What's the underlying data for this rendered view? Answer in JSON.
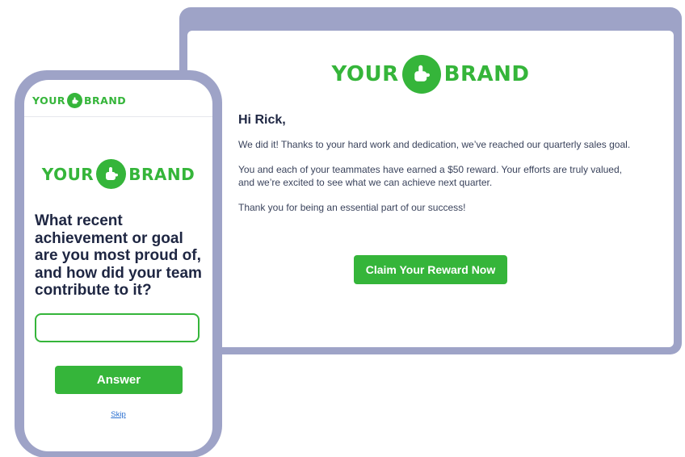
{
  "brand": {
    "left": "YOUR",
    "right": "BRAND",
    "icon": "pointing-hand-icon",
    "color": "#35b53a"
  },
  "email": {
    "greeting": "Hi Rick,",
    "paragraphs": [
      "We did it! Thanks to your hard work and dedication, we’ve reached our quarterly sales goal.",
      "You and each of your teammates have earned a $50 reward. Your efforts are truly valued, and we’re excited to see what we can achieve next quarter.",
      "Thank you for being an essential part of our success!"
    ],
    "cta_label": "Claim Your Reward  Now"
  },
  "phone": {
    "question": "What recent achievement or goal are you most proud of, and how did your team contribute to it?",
    "input_value": "",
    "answer_label": "Answer",
    "skip_label": "Skip"
  },
  "colors": {
    "frame": "#9ea3c7",
    "accent": "#35b53a",
    "text": "#1e2642",
    "link": "#2a6fd0"
  }
}
